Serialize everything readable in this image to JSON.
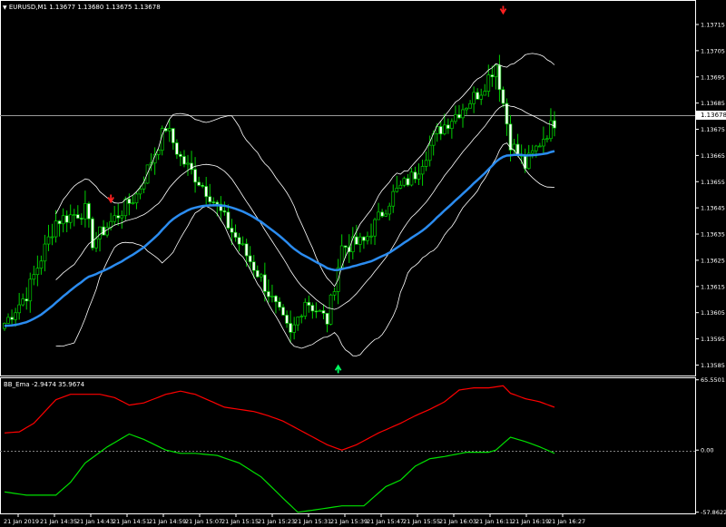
{
  "main_title": "EURUSD,M1",
  "main_ohlc": "1.13677 1.13680 1.13675 1.13678",
  "indicator_title": "BB_Ema",
  "indicator_values": "-2.9474 35.9674",
  "current_price": "1.13678",
  "colors": {
    "background": "#000000",
    "candle": "#00d000",
    "candle_bull_fill": "#000000",
    "candle_bear_fill": "#ffffff",
    "bands": "#ffffff",
    "ema": "#2b8cf0",
    "indicator_red": "#ff0000",
    "indicator_green": "#00e000",
    "sell_arrow": "#ff2020",
    "buy_arrow": "#00ff60"
  },
  "chart_data": {
    "type": "line",
    "price_ticks": [
      "1.13715",
      "1.13705",
      "1.13695",
      "1.13685",
      "1.13675",
      "1.13665",
      "1.13655",
      "1.13645",
      "1.13635",
      "1.13625",
      "1.13615",
      "1.13605",
      "1.13595",
      "1.13585"
    ],
    "time_ticks": [
      "21 Jan 2019",
      "21 Jan 14:35",
      "21 Jan 14:43",
      "21 Jan 14:51",
      "21 Jan 14:59",
      "21 Jan 15:07",
      "21 Jan 15:15",
      "21 Jan 15:23",
      "21 Jan 15:31",
      "21 Jan 15:39",
      "21 Jan 15:47",
      "21 Jan 15:55",
      "21 Jan 16:03",
      "21 Jan 16:11",
      "21 Jan 16:19",
      "21 Jan 16:27"
    ],
    "price_range": [
      1.13581,
      1.13724
    ],
    "indicator_ticks": [
      "65.5501",
      "0.00",
      "-57.8622"
    ],
    "indicator_range": [
      -59,
      67
    ],
    "close_anchors": [
      [
        0,
        1.13601
      ],
      [
        6,
        1.13612
      ],
      [
        14,
        1.1364
      ],
      [
        22,
        1.13644
      ],
      [
        24,
        1.13632
      ],
      [
        36,
        1.1365
      ],
      [
        44,
        1.13676
      ],
      [
        48,
        1.13664
      ],
      [
        56,
        1.1365
      ],
      [
        62,
        1.13636
      ],
      [
        70,
        1.13618
      ],
      [
        78,
        1.13596
      ],
      [
        82,
        1.1361
      ],
      [
        88,
        1.13602
      ],
      [
        92,
        1.1363
      ],
      [
        98,
        1.13632
      ],
      [
        106,
        1.1365
      ],
      [
        112,
        1.13658
      ],
      [
        118,
        1.13674
      ],
      [
        124,
        1.13682
      ],
      [
        130,
        1.1369
      ],
      [
        134,
        1.137
      ],
      [
        138,
        1.1367
      ],
      [
        142,
        1.13661
      ],
      [
        146,
        1.1367
      ],
      [
        150,
        1.13678
      ]
    ],
    "series": [
      {
        "name": "BB_Ema",
        "values": [
          [
            0,
            16
          ],
          [
            4,
            17
          ],
          [
            8,
            25
          ],
          [
            14,
            47
          ],
          [
            18,
            52
          ],
          [
            26,
            52
          ],
          [
            30,
            49
          ],
          [
            34,
            42
          ],
          [
            38,
            44
          ],
          [
            44,
            52
          ],
          [
            48,
            55
          ],
          [
            52,
            52
          ],
          [
            56,
            46
          ],
          [
            60,
            40
          ],
          [
            64,
            38
          ],
          [
            68,
            36
          ],
          [
            72,
            32
          ],
          [
            76,
            27
          ],
          [
            82,
            16
          ],
          [
            88,
            5
          ],
          [
            92,
            0
          ],
          [
            96,
            5
          ],
          [
            102,
            16
          ],
          [
            108,
            25
          ],
          [
            112,
            32
          ],
          [
            116,
            38
          ],
          [
            120,
            45
          ],
          [
            124,
            56
          ],
          [
            128,
            58
          ],
          [
            132,
            58
          ],
          [
            136,
            60
          ],
          [
            138,
            53
          ],
          [
            142,
            48
          ],
          [
            146,
            45
          ],
          [
            150,
            40
          ]
        ]
      },
      {
        "values": [
          [
            0,
            -39
          ],
          [
            6,
            -42
          ],
          [
            14,
            -42
          ],
          [
            18,
            -30
          ],
          [
            22,
            -12
          ],
          [
            28,
            3
          ],
          [
            34,
            15
          ],
          [
            38,
            10
          ],
          [
            44,
            0
          ],
          [
            48,
            -3
          ],
          [
            52,
            -3
          ],
          [
            58,
            -5
          ],
          [
            64,
            -12
          ],
          [
            70,
            -25
          ],
          [
            76,
            -45
          ],
          [
            80,
            -58
          ],
          [
            86,
            -55
          ],
          [
            92,
            -52
          ],
          [
            98,
            -52
          ],
          [
            104,
            -34
          ],
          [
            108,
            -28
          ],
          [
            112,
            -15
          ],
          [
            116,
            -8
          ],
          [
            120,
            -6
          ],
          [
            126,
            -2
          ],
          [
            132,
            -2
          ],
          [
            134,
            0
          ],
          [
            138,
            12
          ],
          [
            142,
            8
          ],
          [
            146,
            3
          ],
          [
            150,
            -3
          ]
        ]
      }
    ],
    "signals": [
      {
        "type": "sell",
        "bar": 29,
        "price": 1.13648
      },
      {
        "type": "buy",
        "bar": 91,
        "price": 1.13584
      },
      {
        "type": "sell",
        "bar": 136,
        "price": 1.1372
      }
    ],
    "grid": false
  }
}
